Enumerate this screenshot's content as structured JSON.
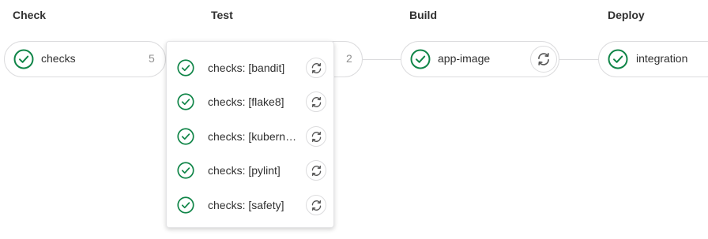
{
  "colors": {
    "success": "#108548",
    "border": "#dcdcde",
    "text": "#303030",
    "muted": "#909090"
  },
  "stages": [
    {
      "title": "Check"
    },
    {
      "title": "Test"
    },
    {
      "title": "Build"
    },
    {
      "title": "Deploy"
    }
  ],
  "jobs": {
    "checks": {
      "name": "checks",
      "count": "5",
      "status": "success",
      "icon": "check-circle-icon"
    },
    "test_group": {
      "count": "2",
      "status": "success"
    },
    "app_image": {
      "name": "app-image",
      "status": "success",
      "icon": "check-circle-icon",
      "action_icon": "retry-icon"
    },
    "integration": {
      "name": "integration",
      "status": "success",
      "icon": "check-circle-icon"
    }
  },
  "dropdown": {
    "items": [
      {
        "name": "checks: [bandit]",
        "status": "success",
        "action_icon": "retry-icon"
      },
      {
        "name": "checks: [flake8]",
        "status": "success",
        "action_icon": "retry-icon"
      },
      {
        "name": "checks: [kubernetes]",
        "status": "success",
        "action_icon": "retry-icon"
      },
      {
        "name": "checks: [pylint]",
        "status": "success",
        "action_icon": "retry-icon"
      },
      {
        "name": "checks: [safety]",
        "status": "success",
        "action_icon": "retry-icon"
      }
    ]
  }
}
